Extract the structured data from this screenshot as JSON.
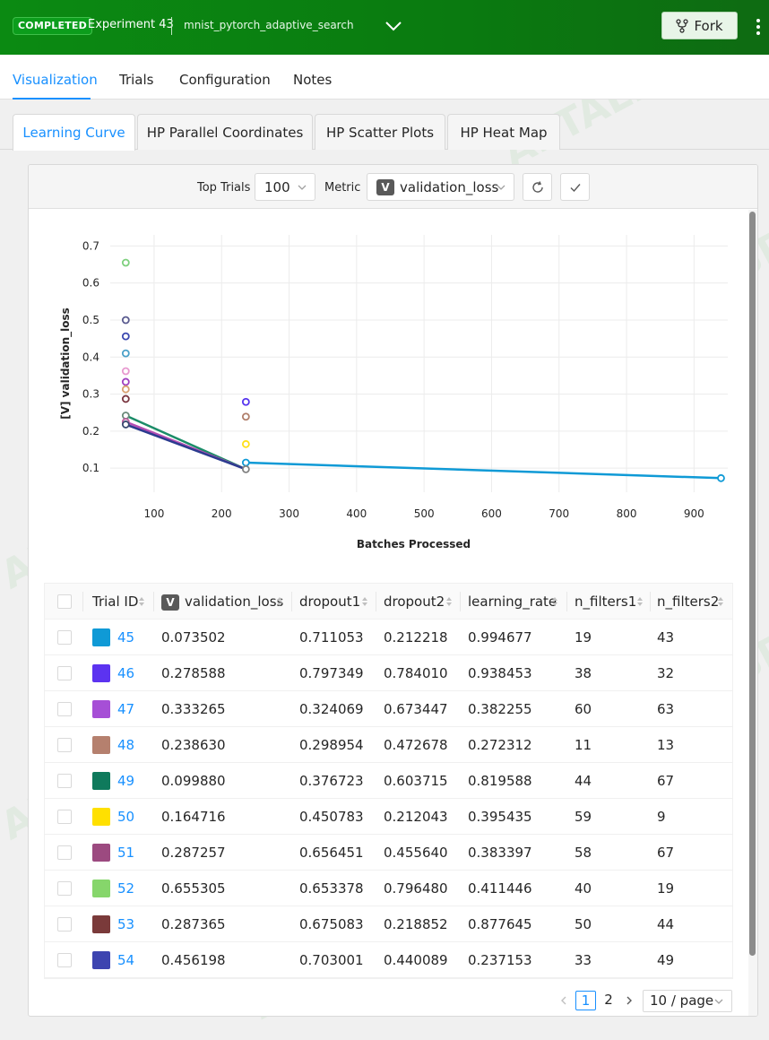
{
  "header": {
    "status": "COMPLETED",
    "experiment_title": "Experiment 43",
    "experiment_name": "mnist_pytorch_adaptive_search",
    "fork_label": "Fork",
    "brand_color": "#0b8a12"
  },
  "main_tabs": [
    {
      "label": "Visualization",
      "active": true
    },
    {
      "label": "Trials",
      "active": false
    },
    {
      "label": "Configuration",
      "active": false
    },
    {
      "label": "Notes",
      "active": false
    }
  ],
  "sub_tabs": [
    {
      "label": "Learning Curve",
      "active": true
    },
    {
      "label": "HP Parallel Coordinates",
      "active": false
    },
    {
      "label": "HP Scatter Plots",
      "active": false
    },
    {
      "label": "HP Heat Map",
      "active": false
    }
  ],
  "toolbar": {
    "top_trials_label": "Top Trials",
    "top_trials_value": "100",
    "metric_label": "Metric",
    "metric_badge": "V",
    "metric_value": "validation_loss"
  },
  "watermark": "AI TALENT SPACE",
  "chart_data": {
    "type": "scatter",
    "xlabel": "Batches Processed",
    "ylabel": "[V] validation_loss",
    "xlim": [
      35,
      950
    ],
    "ylim": [
      0.035,
      0.73
    ],
    "x_ticks": [
      100,
      200,
      300,
      400,
      500,
      600,
      700,
      800,
      900
    ],
    "y_ticks": [
      0.1,
      0.2,
      0.3,
      0.4,
      0.5,
      0.6,
      0.7
    ],
    "grid": true,
    "lines": [
      {
        "color": "#0f9ad6",
        "points": [
          [
            236,
            0.115
          ],
          [
            940,
            0.073
          ]
        ]
      },
      {
        "color": "#1b8c68",
        "points": [
          [
            58,
            0.242
          ],
          [
            236,
            0.097
          ]
        ]
      },
      {
        "color": "#b34db3",
        "points": [
          [
            58,
            0.225
          ],
          [
            236,
            0.097
          ]
        ]
      },
      {
        "color": "#2b3b8f",
        "points": [
          [
            58,
            0.218
          ],
          [
            236,
            0.097
          ]
        ]
      }
    ],
    "points": [
      {
        "x": 58,
        "y": 0.655,
        "color": "#7ed07e"
      },
      {
        "x": 58,
        "y": 0.5,
        "color": "#595a8f"
      },
      {
        "x": 58,
        "y": 0.456,
        "color": "#3b48b0"
      },
      {
        "x": 58,
        "y": 0.41,
        "color": "#4aa0c8"
      },
      {
        "x": 58,
        "y": 0.362,
        "color": "#e89ad0"
      },
      {
        "x": 58,
        "y": 0.333,
        "color": "#a040c0"
      },
      {
        "x": 58,
        "y": 0.313,
        "color": "#d8a070"
      },
      {
        "x": 58,
        "y": 0.287,
        "color": "#7a3640"
      },
      {
        "x": 58,
        "y": 0.242,
        "color": "#6b8a7a"
      },
      {
        "x": 58,
        "y": 0.225,
        "color": "#c060a0"
      },
      {
        "x": 58,
        "y": 0.218,
        "color": "#3a4a70"
      },
      {
        "x": 236,
        "y": 0.279,
        "color": "#5533ee"
      },
      {
        "x": 236,
        "y": 0.239,
        "color": "#b07e6a"
      },
      {
        "x": 236,
        "y": 0.165,
        "color": "#ffe018"
      },
      {
        "x": 236,
        "y": 0.115,
        "color": "#0f9ad6"
      },
      {
        "x": 236,
        "y": 0.097,
        "color": "#808080"
      },
      {
        "x": 940,
        "y": 0.073,
        "color": "#0f9ad6"
      }
    ]
  },
  "table": {
    "columns": [
      "Trial ID",
      "validation_loss",
      "dropout1",
      "dropout2",
      "learning_rate",
      "n_filters1",
      "n_filters2"
    ],
    "metric_badge": "V",
    "rows": [
      {
        "id": "45",
        "color": "#0f9ad6",
        "validation_loss": "0.073502",
        "dropout1": "0.711053",
        "dropout2": "0.212218",
        "learning_rate": "0.994677",
        "n_filters1": "19",
        "n_filters2": "43"
      },
      {
        "id": "46",
        "color": "#5c33f0",
        "validation_loss": "0.278588",
        "dropout1": "0.797349",
        "dropout2": "0.784010",
        "learning_rate": "0.938453",
        "n_filters1": "38",
        "n_filters2": "32"
      },
      {
        "id": "47",
        "color": "#a64fd6",
        "validation_loss": "0.333265",
        "dropout1": "0.324069",
        "dropout2": "0.673447",
        "learning_rate": "0.382255",
        "n_filters1": "60",
        "n_filters2": "63"
      },
      {
        "id": "48",
        "color": "#b5806e",
        "validation_loss": "0.238630",
        "dropout1": "0.298954",
        "dropout2": "0.472678",
        "learning_rate": "0.272312",
        "n_filters1": "11",
        "n_filters2": "13"
      },
      {
        "id": "49",
        "color": "#0f7a5c",
        "validation_loss": "0.099880",
        "dropout1": "0.376723",
        "dropout2": "0.603715",
        "learning_rate": "0.819588",
        "n_filters1": "44",
        "n_filters2": "67"
      },
      {
        "id": "50",
        "color": "#ffe000",
        "validation_loss": "0.164716",
        "dropout1": "0.450783",
        "dropout2": "0.212043",
        "learning_rate": "0.395435",
        "n_filters1": "59",
        "n_filters2": "9"
      },
      {
        "id": "51",
        "color": "#9c4a80",
        "validation_loss": "0.287257",
        "dropout1": "0.656451",
        "dropout2": "0.455640",
        "learning_rate": "0.383397",
        "n_filters1": "58",
        "n_filters2": "67"
      },
      {
        "id": "52",
        "color": "#86d66b",
        "validation_loss": "0.655305",
        "dropout1": "0.653378",
        "dropout2": "0.796480",
        "learning_rate": "0.411446",
        "n_filters1": "40",
        "n_filters2": "19"
      },
      {
        "id": "53",
        "color": "#7a3a3a",
        "validation_loss": "0.287365",
        "dropout1": "0.675083",
        "dropout2": "0.218852",
        "learning_rate": "0.877645",
        "n_filters1": "50",
        "n_filters2": "44"
      },
      {
        "id": "54",
        "color": "#3d44b0",
        "validation_loss": "0.456198",
        "dropout1": "0.703001",
        "dropout2": "0.440089",
        "learning_rate": "0.237153",
        "n_filters1": "33",
        "n_filters2": "49"
      }
    ]
  },
  "pagination": {
    "pages": [
      "1",
      "2"
    ],
    "current": "1",
    "page_size": "10 / page"
  }
}
